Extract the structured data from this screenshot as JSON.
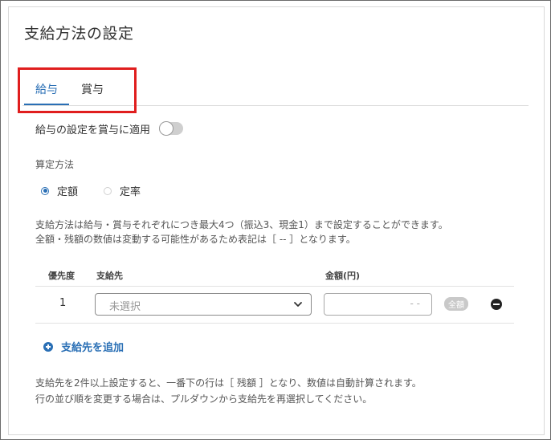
{
  "page": {
    "title": "支給方法の設定"
  },
  "tabs": [
    {
      "label": "給与",
      "active": true
    },
    {
      "label": "賞与",
      "active": false
    }
  ],
  "toggle": {
    "label": "給与の設定を賞与に適用",
    "on": false
  },
  "calculation": {
    "label": "算定方法",
    "options": [
      {
        "label": "定額",
        "selected": true
      },
      {
        "label": "定率",
        "selected": false
      }
    ]
  },
  "notes": {
    "line1": "支給方法は給与・賞与それぞれにつき最大4つ（振込3、現金1）まで設定することができます。",
    "line2": "全額・残額の数値は変動する可能性があるため表記は［ -- ］となります。"
  },
  "table": {
    "headers": {
      "priority": "優先度",
      "destination": "支給先",
      "amount": "金額(円)"
    },
    "rows": [
      {
        "priority": "1",
        "destination_placeholder": "未選択",
        "amount": "- -",
        "badge": "全額"
      }
    ]
  },
  "add_button": {
    "label": "支給先を追加"
  },
  "footer_notes": {
    "line1": "支給先を2件以上設定すると、一番下の行は［ 残額 ］となり、数値は自動計算されます。",
    "line2": "行の並び順を変更する場合は、プルダウンから支給先を再選択してください。"
  },
  "colors": {
    "accent": "#2a6fb5",
    "highlight_border": "#e01e1e"
  }
}
